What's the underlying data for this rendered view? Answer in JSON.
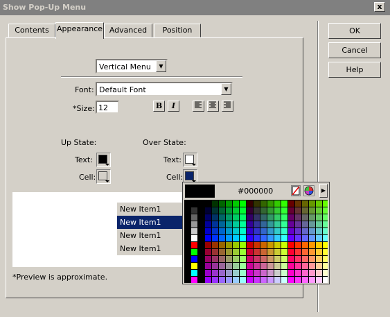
{
  "window": {
    "title": "Show Pop-Up Menu",
    "close_label": "x"
  },
  "tabs": [
    {
      "label": "Contents"
    },
    {
      "label": "Appearance",
      "active": true
    },
    {
      "label": "Advanced"
    },
    {
      "label": "Position"
    }
  ],
  "buttons": {
    "ok": "OK",
    "cancel": "Cancel",
    "help": "Help"
  },
  "appearance": {
    "menu_type": "Vertical Menu",
    "font_label": "Font:",
    "font_value": "Default Font",
    "size_label": "*Size:",
    "size_value": "12",
    "bold_label": "B",
    "italic_label": "I",
    "up_state_label": "Up State:",
    "over_state_label": "Over State:",
    "text_label": "Text:",
    "cell_label": "Cell:",
    "up_text_color": "#000000",
    "up_cell_color": "#d4d0c8",
    "over_text_color": "#ffffff",
    "over_cell_color": "#0a246a"
  },
  "preview": {
    "items": [
      "New Item1",
      "New Item1",
      "New Item1",
      "New Item1"
    ],
    "selected_index": 1,
    "note": "*Preview is approximate."
  },
  "color_picker": {
    "hex": "#000000"
  },
  "colors": {
    "selection": "#0a246a",
    "dialog_bg": "#d4d0c8"
  }
}
